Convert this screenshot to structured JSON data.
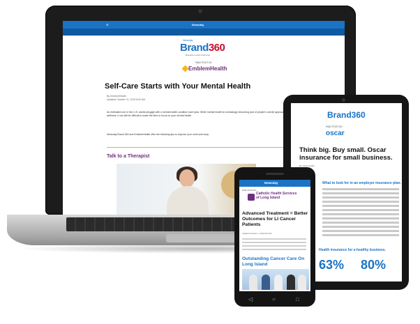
{
  "laptop": {
    "nav_items": [
      "",
      "",
      "",
      "Newsday",
      "",
      ""
    ],
    "logo": {
      "top": "Newsday",
      "main": "Brand",
      "num": "360",
      "sub": "Branded Content Services"
    },
    "paid_by": "PAID POST BY",
    "sponsor": "EmblemHealth",
    "headline": "Self-Care Starts with Your Mental Health",
    "meta": "By EmblemHealth",
    "date": "Updated October 21, 2019 8:00 AM",
    "para1": "An estimated one in five U.S. adults struggle with a mental health condition each year. While mental health is increasingly becoming part of people's overall approach to wellness, it can still be difficult to make the time to focus on your mental health.",
    "para2": "Newsday Brand 360 and EmblemHealth offer the following tips to improve your mind and body.",
    "subhead": "Talk to a Therapist"
  },
  "tablet": {
    "logo": "Brand360",
    "paid_by": "PAID POST BY",
    "sponsor": "oscar",
    "headline": "Think big. Buy small. Oscar insurance for small business.",
    "meta": "By Oscar Health",
    "subhead": "What to look for in an employer insurance plan.",
    "subhead2": "Health insurance for a healthy business.",
    "stat1": "63%",
    "stat2": "80%"
  },
  "phone": {
    "nav_logo": "Newsday",
    "paid_by": "PAID POST BY",
    "sponsor": "Catholic Health Services of Long Island",
    "headline": "Advanced Treatment = Better Outcomes for LI Cancer Patients",
    "meta": "Updated October 1, 2019 9:00 AM",
    "subhead": "Outstanding Cancer Care On Long Island"
  },
  "colors": {
    "brand_blue": "#1a73c5",
    "purple": "#6d2f7f",
    "red": "#c8102e"
  }
}
